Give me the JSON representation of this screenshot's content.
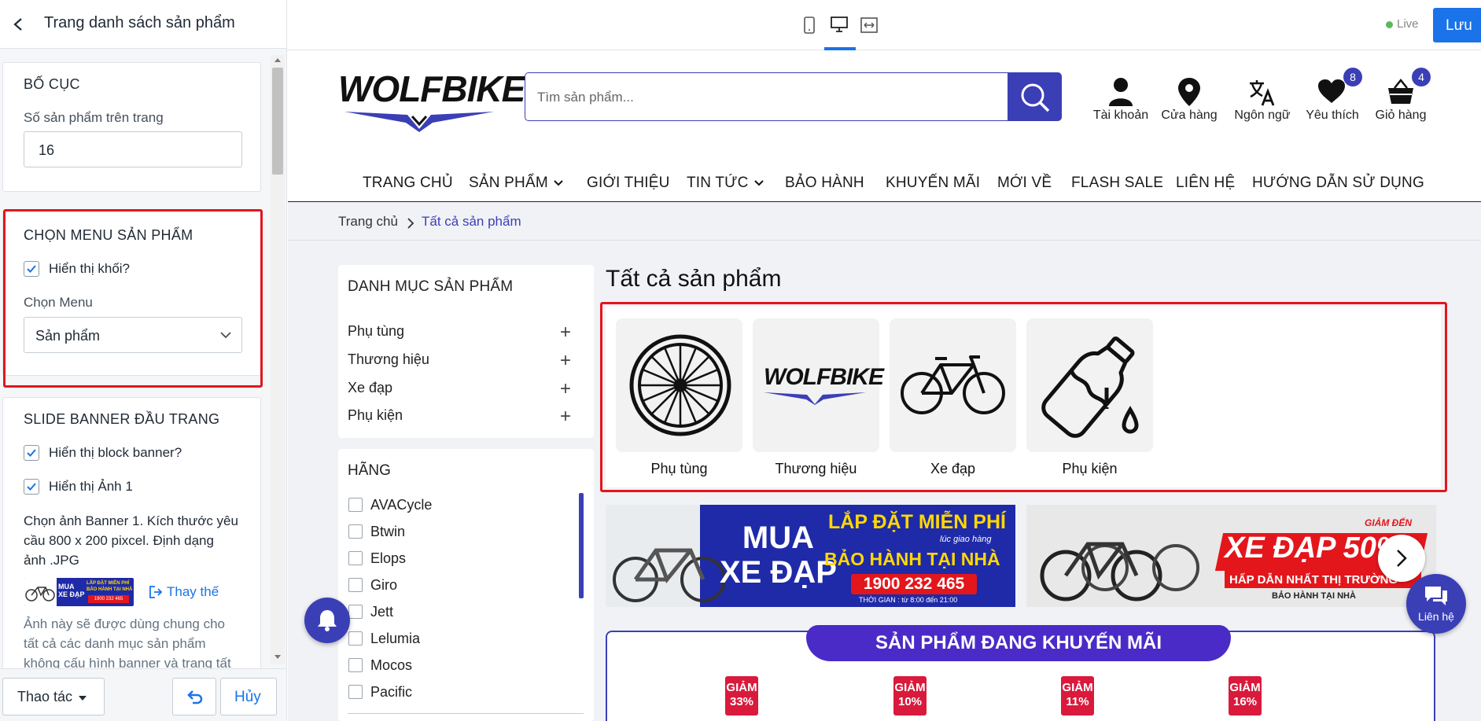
{
  "editor": {
    "title": "Trang danh sách sản phẩm",
    "layout": {
      "title": "BỐ CỤC",
      "per_page_label": "Số sản phẩm trên trang",
      "per_page_value": "16"
    },
    "menu": {
      "title": "CHỌN MENU SẢN PHẨM",
      "show_block_label": "Hiển thị khối?",
      "show_block_checked": true,
      "menu_label": "Chọn Menu",
      "menu_value": "Sản phẩm"
    },
    "banner": {
      "title": "SLIDE BANNER ĐẦU TRANG",
      "show_banner_label": "Hiển thị block banner?",
      "show_image1_label": "Hiển thị Ảnh 1",
      "desc_line1": "Chọn ảnh Banner 1. Kích thước yêu",
      "desc_line2": "cầu 800 x 200 pixcel. Định dạng",
      "desc_line3": "ảnh .JPG",
      "replace_label": "Thay thế",
      "note_line1": "Ảnh này sẽ được dùng chung cho",
      "note_line2": "tất cả các danh mục sản phẩm",
      "note_line3": "không cấu hình banner và trang tất"
    },
    "footer": {
      "actions_label": "Thao tác",
      "cancel_label": "Hủy"
    }
  },
  "toolbar": {
    "live_label": "Live",
    "save_label": "Lưu"
  },
  "store": {
    "logo_text": "WOLFBIKE",
    "search_placeholder": "Tìm sản phẩm...",
    "header_icons": [
      {
        "label": "Tài khoản",
        "icon": "user-icon"
      },
      {
        "label": "Cửa hàng",
        "icon": "location-pin-icon"
      },
      {
        "label": "Ngôn ngữ",
        "icon": "translate-icon"
      },
      {
        "label": "Yêu thích",
        "icon": "heart-icon",
        "badge": "8"
      },
      {
        "label": "Giỏ hàng",
        "icon": "basket-icon",
        "badge": "4"
      }
    ],
    "nav": [
      "TRANG CHỦ",
      "SẢN PHẨM",
      "GIỚI THIỆU",
      "TIN TỨC",
      "BẢO HÀNH",
      "KHUYẾN MÃI",
      "MỚI VỀ",
      "FLASH SALE",
      "LIÊN HỆ",
      "HƯỚNG DẪN SỬ DỤNG"
    ],
    "breadcrumb": {
      "home": "Trang chủ",
      "current": "Tất cả sản phẩm"
    },
    "categories_title": "DANH MỤC SẢN PHẨM",
    "categories": [
      "Phụ tùng",
      "Thương hiệu",
      "Xe đạp",
      "Phụ kiện"
    ],
    "brands_title": "HÃNG",
    "brands": [
      "AVACycle",
      "Btwin",
      "Elops",
      "Giro",
      "Jett",
      "Lelumia",
      "Mocos",
      "Pacific"
    ],
    "page_title": "Tất cả sản phẩm",
    "tiles": [
      {
        "label": "Phụ tùng",
        "icon": "wheel-icon"
      },
      {
        "label": "Thương hiệu",
        "icon": "wolfbike-logo-icon"
      },
      {
        "label": "Xe đạp",
        "icon": "bicycle-icon"
      },
      {
        "label": "Phụ kiện",
        "icon": "water-bottle-icon"
      }
    ],
    "banner1": {
      "left_line1": "MUA",
      "left_line2": "XE ĐẠP",
      "right_line1": "LẮP ĐẶT MIỄN PHÍ",
      "small": "lúc giao hàng",
      "right_line2": "BẢO HÀNH TẠI NHÀ",
      "phone": "1900 232 465",
      "time": "THỜI GIAN : từ 8:00 đến 21:00"
    },
    "banner2": {
      "small": "GIẢM ĐẾN",
      "big": "XE ĐẠP 50%",
      "line2": "HẤP DẪN NHẤT THỊ TRƯỜNG",
      "line3": "BẢO HÀNH TẠI NHÀ"
    },
    "promo_title": "SẢN PHẨM ĐANG KHUYẾN MÃI",
    "promo_tags": [
      {
        "label": "GIẢM",
        "value": "33%"
      },
      {
        "label": "GIẢM",
        "value": "10%"
      },
      {
        "label": "GIẢM",
        "value": "11%"
      },
      {
        "label": "GIẢM",
        "value": "16%"
      }
    ],
    "contact_label": "Liên hệ"
  },
  "colors": {
    "accent": "#3b3fb6",
    "save": "#1a73e8",
    "highlight": "#e3161c",
    "live": "#5cb85c"
  }
}
